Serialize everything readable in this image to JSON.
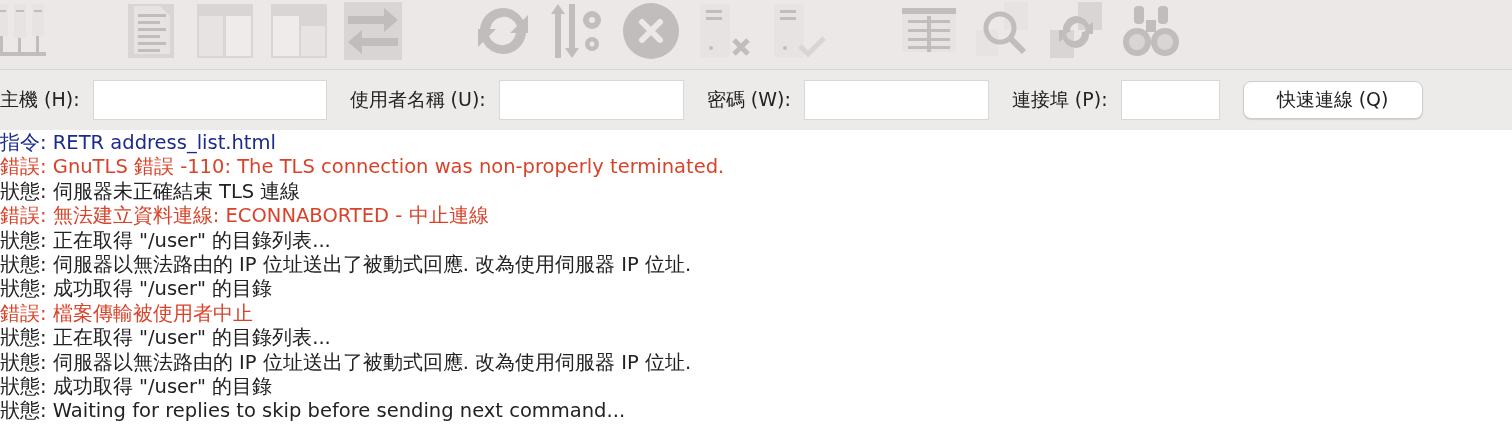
{
  "toolbar": {
    "groups": [
      [
        {
          "kind": "servers",
          "disabled": true
        }
      ],
      [
        {
          "kind": "log",
          "disabled": true
        },
        {
          "kind": "localtree",
          "disabled": true
        },
        {
          "kind": "remotetree",
          "disabled": true
        },
        {
          "kind": "transfer",
          "disabled": true
        }
      ],
      [
        {
          "kind": "refresh",
          "disabled": true
        },
        {
          "kind": "process",
          "disabled": true
        },
        {
          "kind": "cancel",
          "disabled": true
        },
        {
          "kind": "disconnect",
          "disabled": true
        },
        {
          "kind": "reconnect",
          "disabled": true
        }
      ],
      [
        {
          "kind": "filter",
          "disabled": true
        },
        {
          "kind": "compare",
          "disabled": true
        },
        {
          "kind": "sync",
          "disabled": true
        },
        {
          "kind": "find",
          "disabled": true
        }
      ]
    ]
  },
  "quickconnect": {
    "fields": [
      {
        "label": "主機 (H):",
        "kind": "host"
      },
      {
        "label": "使用者名稱 (U):",
        "kind": "user"
      },
      {
        "label": "密碼 (W):",
        "kind": "password"
      },
      {
        "label": "連接埠 (P):",
        "kind": "port"
      }
    ],
    "button": "快速連線 (Q)"
  },
  "log": [
    {
      "kind": "command",
      "prefix": "指令:",
      "text": "RETR address_list.html"
    },
    {
      "kind": "error",
      "prefix": "錯誤:",
      "text": "GnuTLS 錯誤 -110: The TLS connection was non-properly terminated."
    },
    {
      "kind": "status",
      "prefix": "狀態:",
      "text": "伺服器未正確結束 TLS 連線"
    },
    {
      "kind": "error",
      "prefix": "錯誤:",
      "text": "無法建立資料連線: ECONNABORTED - 中止連線"
    },
    {
      "kind": "status",
      "prefix": "狀態:",
      "text": "正在取得 \"/user\" 的目錄列表..."
    },
    {
      "kind": "status",
      "prefix": "狀態:",
      "text": "伺服器以無法路由的 IP 位址送出了被動式回應. 改為使用伺服器 IP 位址."
    },
    {
      "kind": "status",
      "prefix": "狀態:",
      "text": "成功取得 \"/user\" 的目錄"
    },
    {
      "kind": "error",
      "prefix": "錯誤:",
      "text": "檔案傳輸被使用者中止"
    },
    {
      "kind": "status",
      "prefix": "狀態:",
      "text": "正在取得 \"/user\" 的目錄列表..."
    },
    {
      "kind": "status",
      "prefix": "狀態:",
      "text": "伺服器以無法路由的 IP 位址送出了被動式回應. 改為使用伺服器 IP 位址."
    },
    {
      "kind": "status",
      "prefix": "狀態:",
      "text": "成功取得 \"/user\" 的目錄"
    },
    {
      "kind": "status",
      "prefix": "狀態:",
      "text": "Waiting for replies to skip before sending next command..."
    }
  ]
}
